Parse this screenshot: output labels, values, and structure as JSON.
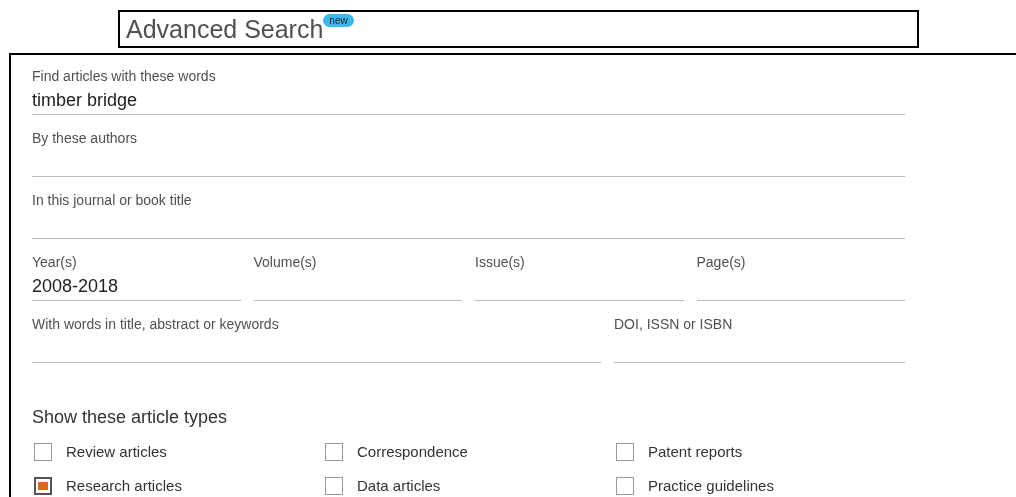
{
  "title": {
    "text": "Advanced Search",
    "badge": "new"
  },
  "field_rows": [
    {
      "fields": [
        {
          "label": "Find articles with these words",
          "value": "timber bridge"
        }
      ]
    },
    {
      "fields": [
        {
          "label": "By these authors"
        }
      ]
    },
    {
      "fields": [
        {
          "label": "In this journal or book title"
        }
      ]
    },
    {
      "fields": [
        {
          "label": "Year(s)",
          "value": "2008-2018"
        },
        {
          "label": "Volume(s)"
        },
        {
          "label": "Issue(s)"
        },
        {
          "label": "Page(s)"
        }
      ]
    },
    {
      "fields": [
        {
          "label": "With words in title, abstract or keywords"
        },
        {
          "label": "DOI, ISSN or ISBN"
        }
      ]
    }
  ],
  "article_types": {
    "heading": "Show these article types",
    "options": [
      {
        "label": "Review articles",
        "checked": false
      },
      {
        "label": "Correspondence",
        "checked": false
      },
      {
        "label": "Patent reports",
        "checked": false
      },
      {
        "label": "Research articles",
        "checked": true
      },
      {
        "label": "Data articles",
        "checked": false
      },
      {
        "label": "Practice guidelines",
        "checked": false
      }
    ]
  }
}
